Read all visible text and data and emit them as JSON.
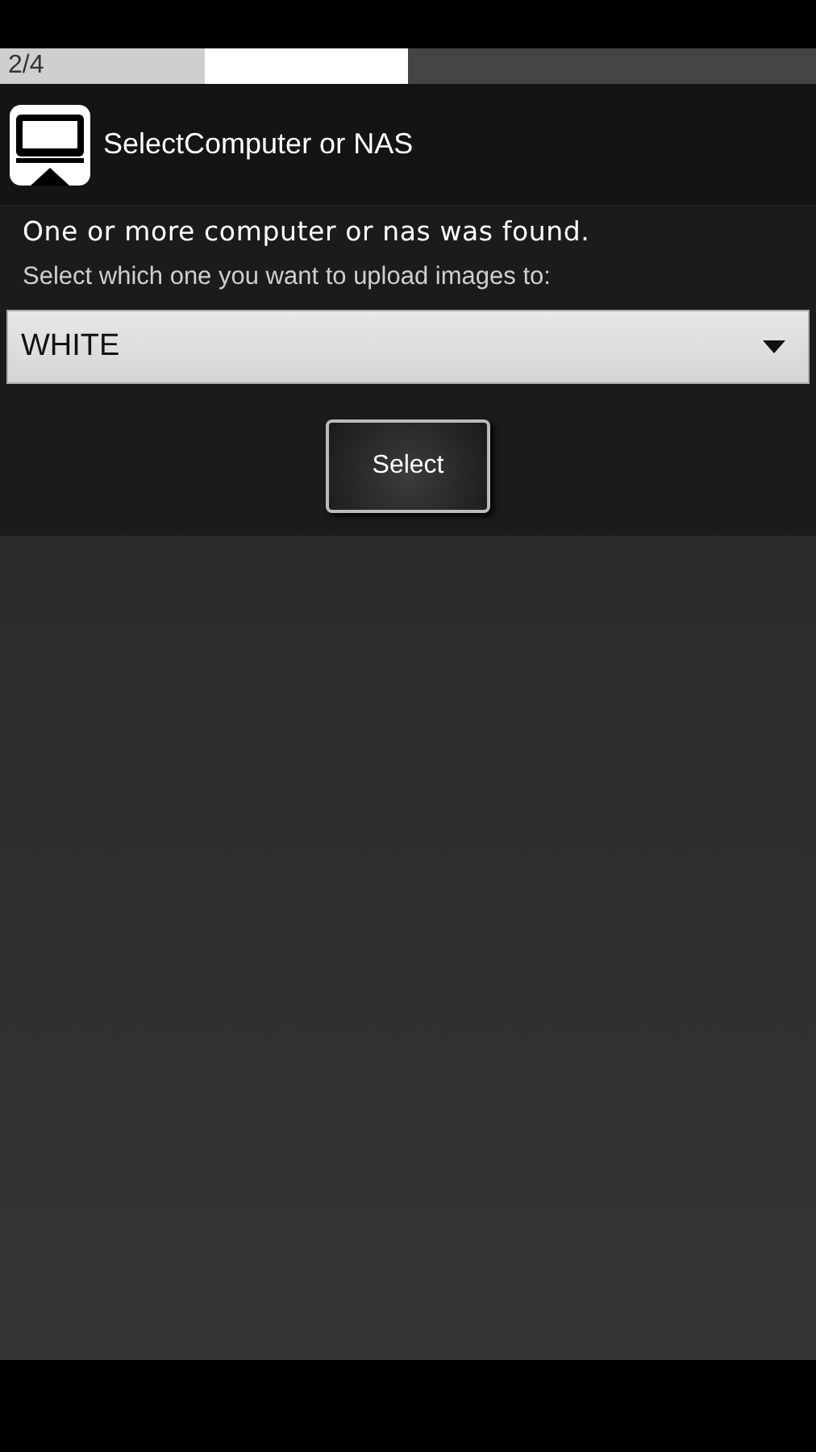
{
  "step_indicator": {
    "label": "2/4",
    "segments": [
      {
        "kind": "done"
      },
      {
        "kind": "current"
      },
      {
        "kind": "upcoming"
      },
      {
        "kind": "upcoming"
      }
    ]
  },
  "header": {
    "title": "SelectComputer or NAS"
  },
  "message": "One or more computer or nas was found.",
  "prompt": "Select which one you want to upload images to:",
  "dropdown": {
    "value": "WHITE"
  },
  "buttons": [
    "Select"
  ]
}
